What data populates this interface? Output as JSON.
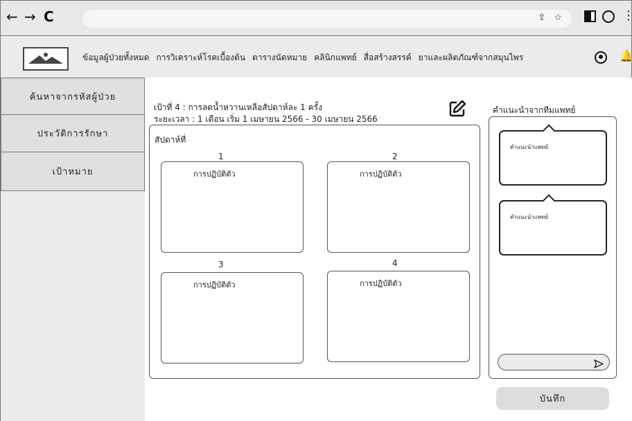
{
  "browser": {
    "back": "←",
    "forward": "→",
    "reload": "C",
    "url_icons": "⇪ ☆",
    "menu_dots": "⋮"
  },
  "header": {
    "nav": [
      "ข้อมูลผู้ป่วยทั้งหมด",
      "การวิเคราะห์โรคเบื้องต้น",
      "ตารางนัดหมาย",
      "คลินิกแพทย์",
      "สื่อสร้างสรรค์",
      "ยาและผลิตภัณฑ์จากสมุนไพร"
    ],
    "bell": "🔔"
  },
  "sidebar": {
    "items": [
      {
        "label": "ค้นหาจากรหัสผู้ป่วย"
      },
      {
        "label": "ประวัติการรักษา"
      },
      {
        "label": "เป้าหมาย"
      }
    ]
  },
  "goal": {
    "title": "เป้าที่ 4 : การลดน้ำหวานเหลือสัปดาห์ละ 1 ครั้ง",
    "period": "ระยะเวลา : 1 เดือน เริ่ม 1 เมษายน 2566 - 30 เมษายน 2566",
    "weeks_label": "สัปดาห์ที่",
    "weeks": [
      {
        "number": "1",
        "text": "การปฏิบัติตัว"
      },
      {
        "number": "2",
        "text": "การปฏิบัติตัว"
      },
      {
        "number": "3",
        "text": "การปฏิบัติตัว"
      },
      {
        "number": "4",
        "text": "การปฏิบัติตัว"
      }
    ]
  },
  "advice": {
    "title": "คำแนะนำจากทีมแพทย์",
    "bubbles": [
      {
        "text": "คำแนะนำแพทย์"
      },
      {
        "text": "คำแนะนำแพทย์"
      }
    ],
    "input_value": ""
  },
  "actions": {
    "save_label": "บันทึก"
  },
  "icons": {
    "logo": "image-placeholder-icon",
    "edit": "edit-icon",
    "send": "send-icon",
    "user": "user-circle-icon",
    "bell": "bell-icon"
  }
}
